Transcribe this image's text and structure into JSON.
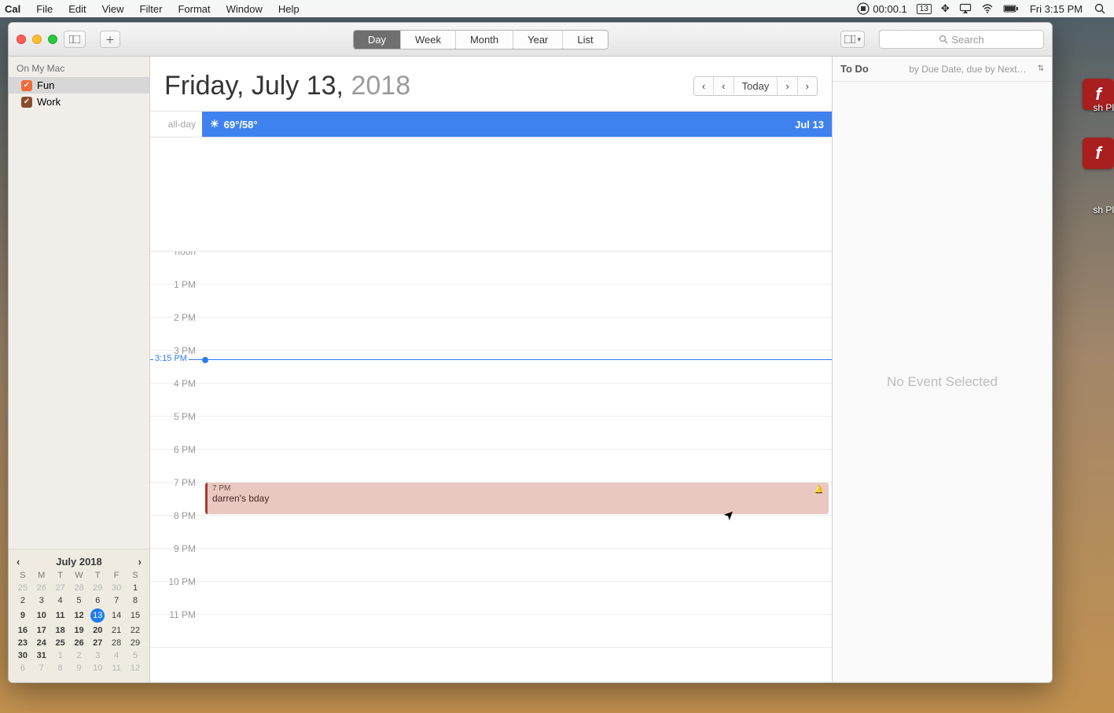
{
  "menubar": {
    "app": "Cal",
    "items": [
      "File",
      "Edit",
      "View",
      "Filter",
      "Format",
      "Window",
      "Help"
    ],
    "timer": "00:00.1",
    "date_icon": "13",
    "clock": "Fri 3:15 PM"
  },
  "toolbar": {
    "views": [
      "Day",
      "Week",
      "Month",
      "Year",
      "List"
    ],
    "active_view": "Day",
    "search_placeholder": "Search"
  },
  "sidebar": {
    "header": "On My Mac",
    "calendars": [
      {
        "label": "Fun",
        "color": "#ef6b3a",
        "selected": true
      },
      {
        "label": "Work",
        "color": "#8a4a2e",
        "selected": false
      }
    ]
  },
  "minical": {
    "title": "July 2018",
    "dow": [
      "S",
      "M",
      "T",
      "W",
      "T",
      "F",
      "S"
    ],
    "weeks": [
      [
        {
          "n": "25",
          "out": true
        },
        {
          "n": "26",
          "out": true
        },
        {
          "n": "27",
          "out": true
        },
        {
          "n": "28",
          "out": true
        },
        {
          "n": "29",
          "out": true
        },
        {
          "n": "30",
          "out": true
        },
        {
          "n": "1"
        }
      ],
      [
        {
          "n": "2"
        },
        {
          "n": "3"
        },
        {
          "n": "4"
        },
        {
          "n": "5"
        },
        {
          "n": "6"
        },
        {
          "n": "7"
        },
        {
          "n": "8"
        }
      ],
      [
        {
          "n": "9",
          "bold": true
        },
        {
          "n": "10",
          "bold": true
        },
        {
          "n": "11",
          "bold": true
        },
        {
          "n": "12",
          "bold": true
        },
        {
          "n": "13",
          "today": true
        },
        {
          "n": "14"
        },
        {
          "n": "15"
        }
      ],
      [
        {
          "n": "16",
          "bold": true
        },
        {
          "n": "17",
          "bold": true
        },
        {
          "n": "18",
          "bold": true
        },
        {
          "n": "19",
          "bold": true
        },
        {
          "n": "20",
          "bold": true
        },
        {
          "n": "21"
        },
        {
          "n": "22"
        }
      ],
      [
        {
          "n": "23",
          "bold": true
        },
        {
          "n": "24",
          "bold": true
        },
        {
          "n": "25",
          "bold": true
        },
        {
          "n": "26",
          "bold": true
        },
        {
          "n": "27",
          "bold": true
        },
        {
          "n": "28"
        },
        {
          "n": "29"
        }
      ],
      [
        {
          "n": "30",
          "bold": true
        },
        {
          "n": "31",
          "bold": true
        },
        {
          "n": "1",
          "out": true
        },
        {
          "n": "2",
          "out": true
        },
        {
          "n": "3",
          "out": true
        },
        {
          "n": "4",
          "out": true
        },
        {
          "n": "5",
          "out": true
        }
      ],
      [
        {
          "n": "6",
          "out": true
        },
        {
          "n": "7",
          "out": true
        },
        {
          "n": "8",
          "out": true
        },
        {
          "n": "9",
          "out": true
        },
        {
          "n": "10",
          "out": true
        },
        {
          "n": "11",
          "out": true
        },
        {
          "n": "12",
          "out": true
        }
      ]
    ]
  },
  "dayview": {
    "title_weekday": "Friday, July 13,",
    "title_year": "2018",
    "today_label": "Today",
    "allday_label": "all-day",
    "weather": "69°/58°",
    "weather_date": "Jul 13",
    "now_label": "3:15 PM",
    "hours": [
      "noon",
      "1 PM",
      "2 PM",
      "3 PM",
      "4 PM",
      "5 PM",
      "6 PM",
      "7 PM",
      "8 PM",
      "9 PM",
      "10 PM",
      "11 PM"
    ],
    "event": {
      "time": "7 PM",
      "title": "darren's bday"
    }
  },
  "todo": {
    "title": "To Do",
    "sort": "by Due Date, due by Next…",
    "empty": "No Event Selected"
  },
  "desktop_labels": [
    "sh Pl",
    "sh Pl"
  ]
}
